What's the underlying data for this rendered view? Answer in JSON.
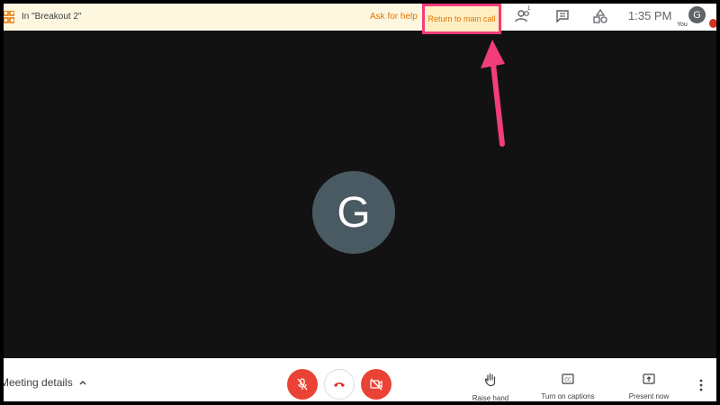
{
  "banner": {
    "room_label": "In \"Breakout 2\"",
    "ask_help": "Ask for help",
    "return_label": "Return to main call"
  },
  "topbar": {
    "people_count": "1",
    "time": "1:35 PM",
    "avatar_initial": "G",
    "you_label": "You"
  },
  "main": {
    "avatar_initial": "G"
  },
  "bottombar": {
    "meeting_details": "Meeting details",
    "raise_hand": "Raise hand",
    "captions": "Turn on captions",
    "present": "Present now"
  },
  "colors": {
    "accent_orange": "#e37400",
    "highlight_pink": "#f23d7d",
    "danger_red": "#ea4335",
    "banner_bg": "#fef7e0"
  },
  "icons": [
    "breakout-room-icon",
    "people-icon",
    "chat-icon",
    "activities-icon",
    "microphone-off-icon",
    "hang-up-icon",
    "camera-off-icon",
    "raise-hand-icon",
    "captions-icon",
    "present-icon",
    "more-options-icon",
    "chevron-up-icon"
  ]
}
